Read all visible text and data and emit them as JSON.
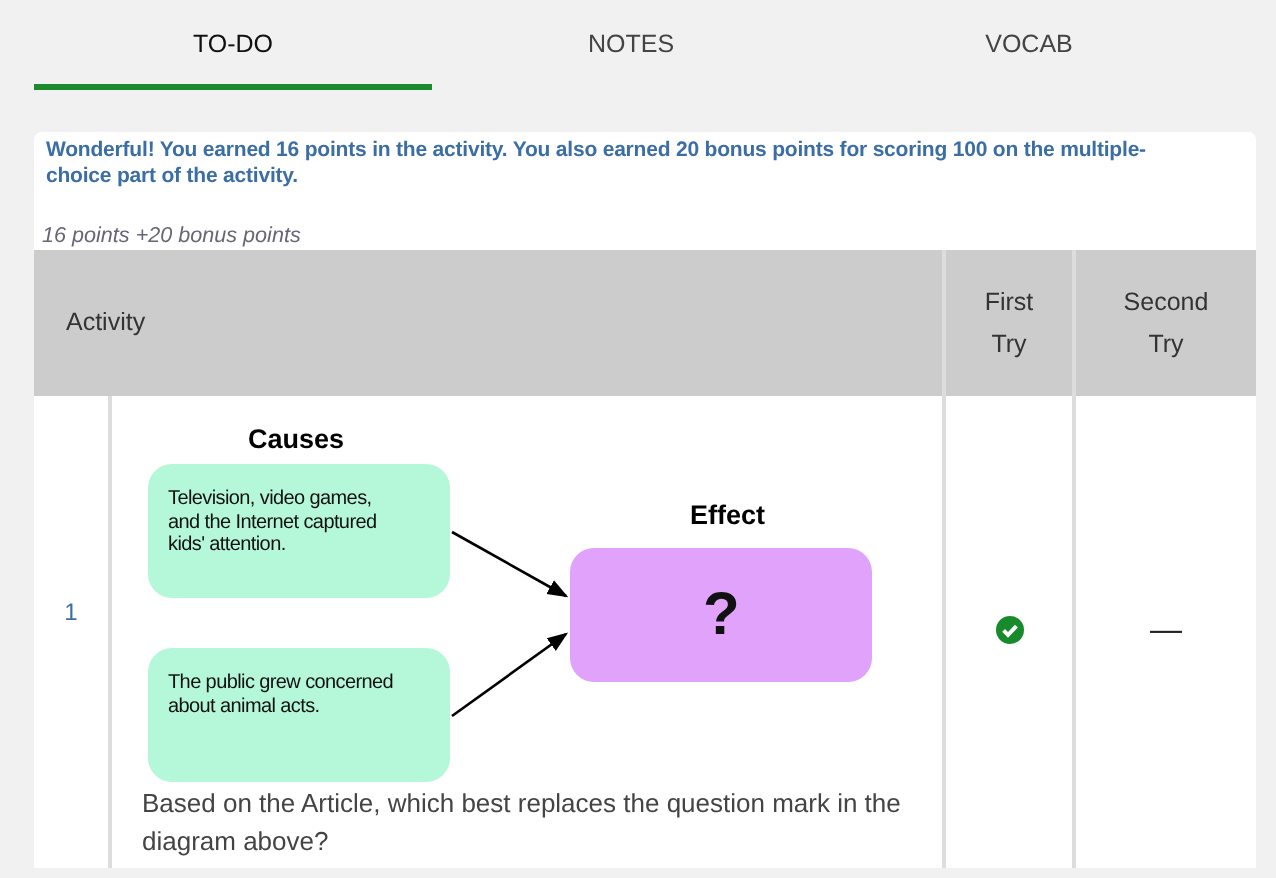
{
  "tabs": [
    {
      "label": "TO-DO",
      "selected": true
    },
    {
      "label": "NOTES",
      "selected": false
    },
    {
      "label": "VOCAB",
      "selected": false
    }
  ],
  "feedback": {
    "message": "Wonderful! You earned 16 points in the activity. You also earned 20 bonus points for scoring 100 on the multiple-choice part of the activity.",
    "points": "16 points +20 bonus points"
  },
  "table": {
    "columns": [
      "Activity",
      "First Try",
      "Second Try"
    ],
    "rows": [
      {
        "number": "1",
        "diagram": {
          "causes_title": "Causes",
          "effect_title": "Effect",
          "causes": [
            "Television, video games, and the Internet captured kids' attention.",
            "The public grew concerned about animal acts."
          ],
          "effect": "?"
        },
        "question": "Based on the Article, which best replaces the question mark in the diagram above?",
        "first_try": {
          "kind": "check"
        },
        "second_try": {
          "kind": "dash",
          "text": "—"
        }
      }
    ]
  }
}
